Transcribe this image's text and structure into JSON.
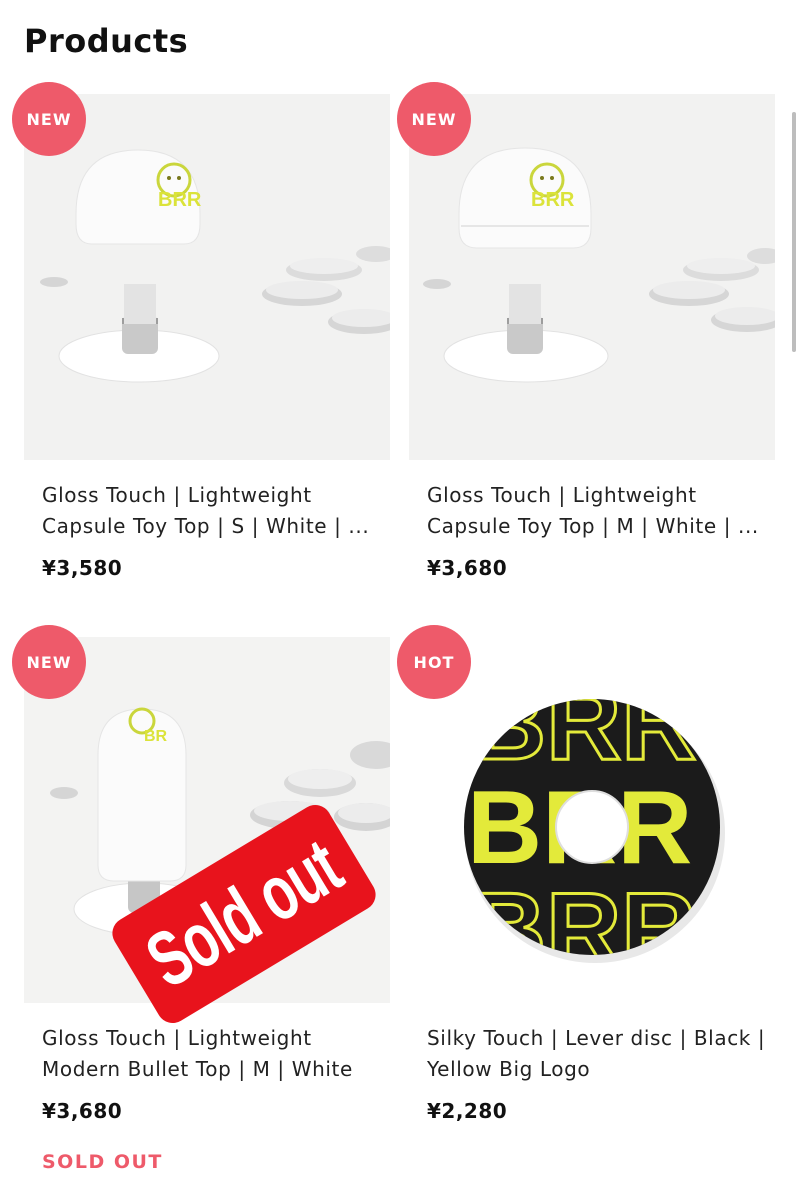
{
  "page": {
    "title": "Products"
  },
  "products": [
    {
      "badge": "NEW",
      "name": "Gloss Touch | Lightweight Capsule Toy Top | S | White | ...",
      "price": "¥3,580",
      "sold_out": false
    },
    {
      "badge": "NEW",
      "name": "Gloss Touch | Lightweight Capsule Toy Top | M | White | ...",
      "price": "¥3,680",
      "sold_out": false
    },
    {
      "badge": "NEW",
      "name": "Gloss Touch | Lightweight Modern Bullet Top | M | White |...",
      "price": "¥3,680",
      "sold_out": true,
      "sold_out_stamp": "Sold out",
      "sold_out_label": "SOLD OUT"
    },
    {
      "badge": "HOT",
      "name": "Silky Touch | Lever disc | Black | Yellow Big Logo",
      "price": "¥2,280",
      "sold_out": false
    }
  ],
  "colors": {
    "badge": "#ee5a6a",
    "sold_out_stamp": "#e8131c",
    "sold_out_text": "#ee5a6a",
    "logo_yellow": "#e3ea3a",
    "disc_black": "#1b1b1b"
  },
  "icons": {
    "product_logo": "brr-tiger-logo-icon"
  }
}
